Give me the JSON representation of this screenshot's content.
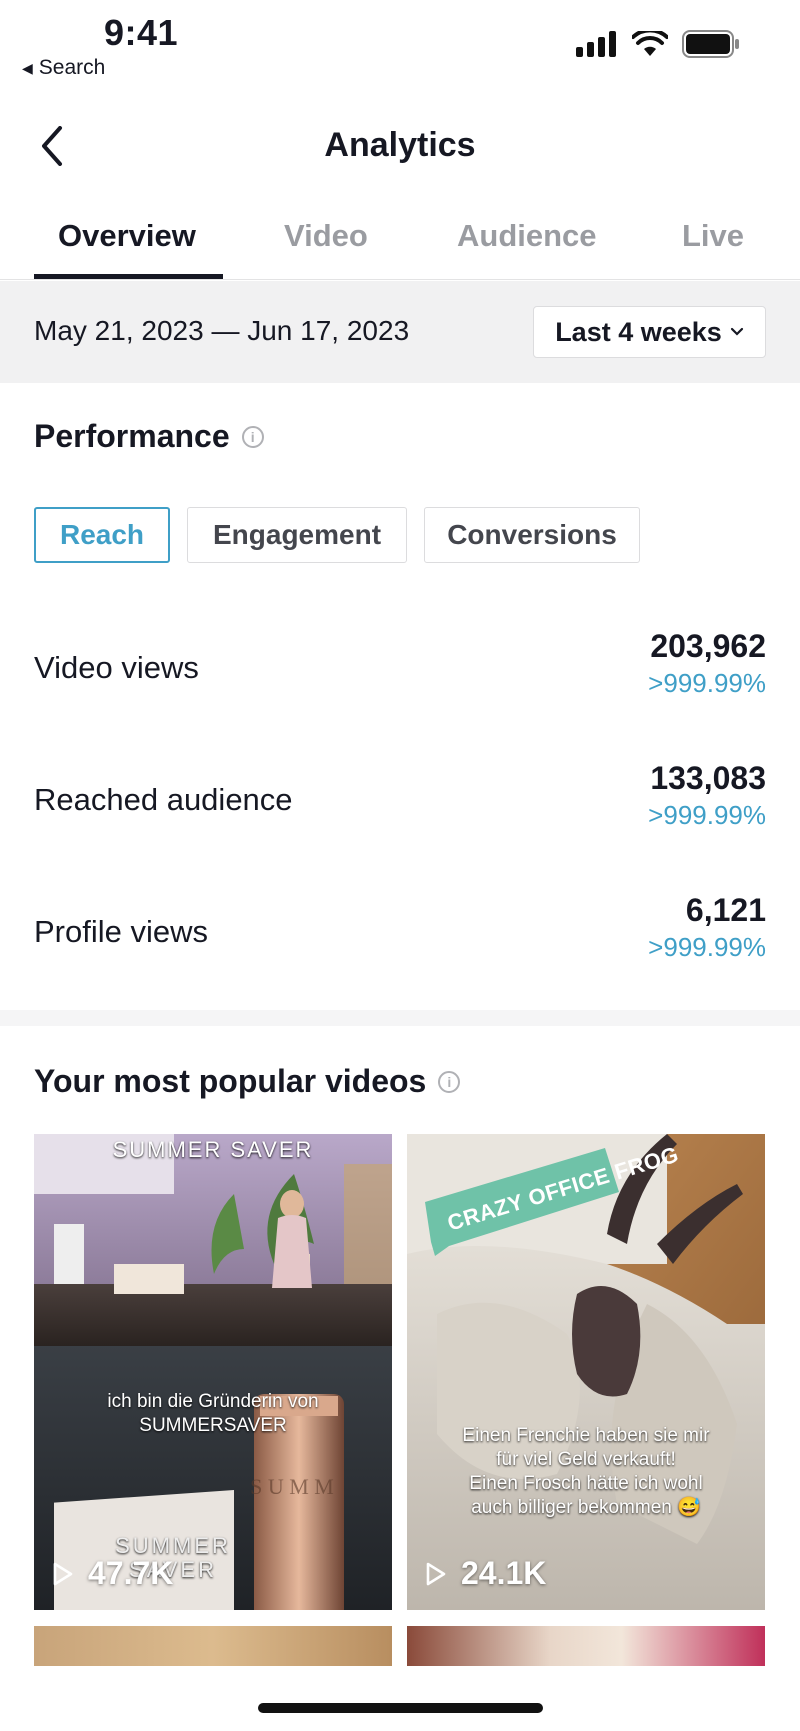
{
  "status_bar": {
    "time": "9:41",
    "back_label": "Search"
  },
  "nav": {
    "title": "Analytics"
  },
  "tabs": [
    {
      "label": "Overview",
      "active": true
    },
    {
      "label": "Video",
      "active": false
    },
    {
      "label": "Audience",
      "active": false
    },
    {
      "label": "Live",
      "active": false
    }
  ],
  "date_range": {
    "text": "May 21, 2023 — Jun 17, 2023",
    "period": "Last 4 weeks"
  },
  "performance": {
    "title": "Performance",
    "filters": [
      {
        "label": "Reach",
        "active": true
      },
      {
        "label": "Engagement",
        "active": false
      },
      {
        "label": "Conversions",
        "active": false
      }
    ],
    "metrics": [
      {
        "label": "Video views",
        "value": "203,962",
        "change": ">999.99%"
      },
      {
        "label": "Reached audience",
        "value": "133,083",
        "change": ">999.99%"
      },
      {
        "label": "Profile views",
        "value": "6,121",
        "change": ">999.99%"
      }
    ]
  },
  "popular_videos": {
    "title": "Your most popular videos",
    "videos": [
      {
        "views": "47.7K",
        "caption_lines": [
          "ich bin die Gründerin von",
          "SUMMERSAVER"
        ],
        "brand_top": "SUMMER SAVER",
        "brand_bottom": "SUMMER SAVER"
      },
      {
        "views": "24.1K",
        "sticker": "CRAZY OFFICE FROG",
        "caption_lines": [
          "Einen Frenchie haben sie mir",
          "für viel Geld verkauft!",
          "Einen Frosch hätte ich wohl",
          "auch billiger bekommen 😅"
        ]
      }
    ]
  },
  "colors": {
    "accent": "#3f9fc7",
    "text": "#161823",
    "muted": "#9a9ca1",
    "band": "#f1f1f2"
  }
}
